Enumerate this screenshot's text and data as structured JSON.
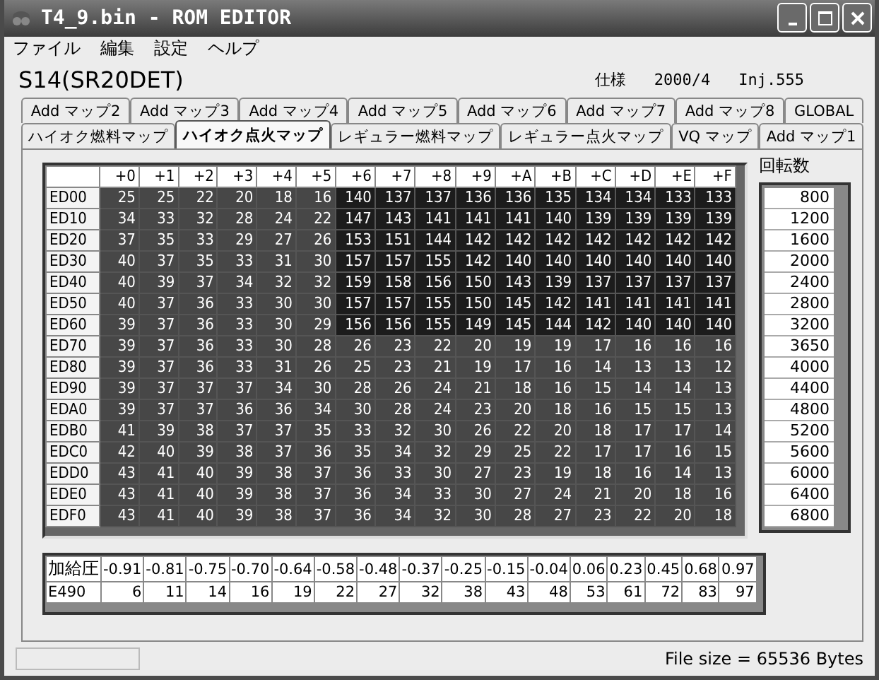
{
  "window": {
    "title": "T4_9.bin - ROM EDITOR"
  },
  "menu": [
    "ファイル",
    "編集",
    "設定",
    "ヘルプ"
  ],
  "header": {
    "model": "S14(SR20DET)",
    "spec_label": "仕様",
    "spec": "2000/4",
    "injector": "Inj.555"
  },
  "tab_rows": [
    [
      {
        "label": "Add マップ2",
        "selected": false
      },
      {
        "label": "Add マップ3",
        "selected": false
      },
      {
        "label": "Add マップ4",
        "selected": false
      },
      {
        "label": "Add マップ5",
        "selected": false
      },
      {
        "label": "Add マップ6",
        "selected": false
      },
      {
        "label": "Add マップ7",
        "selected": false
      },
      {
        "label": "Add マップ8",
        "selected": false
      },
      {
        "label": "GLOBAL",
        "selected": false
      }
    ],
    [
      {
        "label": "ハイオク燃料マップ",
        "selected": false
      },
      {
        "label": "ハイオク点火マップ",
        "selected": true
      },
      {
        "label": "レギュラー燃料マップ",
        "selected": false
      },
      {
        "label": "レギュラー点火マップ",
        "selected": false
      },
      {
        "label": "VQ マップ",
        "selected": false
      },
      {
        "label": "Add マップ1",
        "selected": false
      }
    ]
  ],
  "map": {
    "columns": [
      "+0",
      "+1",
      "+2",
      "+3",
      "+4",
      "+5",
      "+6",
      "+7",
      "+8",
      "+9",
      "+A",
      "+B",
      "+C",
      "+D",
      "+E",
      "+F"
    ],
    "rows": [
      {
        "address": "ED00",
        "values": [
          "25",
          "25",
          "22",
          "20",
          "18",
          "16",
          "140",
          "137",
          "137",
          "136",
          "136",
          "135",
          "134",
          "134",
          "133",
          "133"
        ]
      },
      {
        "address": "ED10",
        "values": [
          "34",
          "33",
          "32",
          "28",
          "24",
          "22",
          "147",
          "143",
          "141",
          "141",
          "141",
          "140",
          "139",
          "139",
          "139",
          "139"
        ]
      },
      {
        "address": "ED20",
        "values": [
          "37",
          "35",
          "33",
          "29",
          "27",
          "26",
          "153",
          "151",
          "144",
          "142",
          "142",
          "142",
          "142",
          "142",
          "142",
          "142"
        ]
      },
      {
        "address": "ED30",
        "values": [
          "40",
          "37",
          "35",
          "33",
          "31",
          "30",
          "157",
          "157",
          "155",
          "142",
          "140",
          "140",
          "140",
          "140",
          "140",
          "140"
        ]
      },
      {
        "address": "ED40",
        "values": [
          "40",
          "39",
          "37",
          "34",
          "32",
          "32",
          "159",
          "158",
          "156",
          "150",
          "143",
          "139",
          "137",
          "137",
          "137",
          "137"
        ]
      },
      {
        "address": "ED50",
        "values": [
          "40",
          "37",
          "36",
          "33",
          "30",
          "30",
          "157",
          "157",
          "155",
          "150",
          "145",
          "142",
          "141",
          "141",
          "141",
          "141"
        ]
      },
      {
        "address": "ED60",
        "values": [
          "39",
          "37",
          "36",
          "33",
          "30",
          "29",
          "156",
          "156",
          "155",
          "149",
          "145",
          "144",
          "142",
          "140",
          "140",
          "140"
        ]
      },
      {
        "address": "ED70",
        "values": [
          "39",
          "37",
          "36",
          "33",
          "30",
          "28",
          "26",
          "23",
          "22",
          "20",
          "19",
          "19",
          "17",
          "16",
          "16",
          "16"
        ]
      },
      {
        "address": "ED80",
        "values": [
          "39",
          "37",
          "36",
          "33",
          "31",
          "26",
          "25",
          "23",
          "21",
          "19",
          "17",
          "16",
          "14",
          "13",
          "13",
          "12"
        ]
      },
      {
        "address": "ED90",
        "values": [
          "39",
          "37",
          "37",
          "37",
          "34",
          "30",
          "28",
          "26",
          "24",
          "21",
          "18",
          "16",
          "15",
          "14",
          "14",
          "13"
        ]
      },
      {
        "address": "EDA0",
        "values": [
          "39",
          "37",
          "37",
          "36",
          "36",
          "34",
          "30",
          "28",
          "24",
          "23",
          "20",
          "18",
          "16",
          "15",
          "15",
          "13"
        ]
      },
      {
        "address": "EDB0",
        "values": [
          "41",
          "39",
          "38",
          "37",
          "37",
          "35",
          "33",
          "32",
          "30",
          "26",
          "22",
          "20",
          "18",
          "17",
          "17",
          "14"
        ]
      },
      {
        "address": "EDC0",
        "values": [
          "42",
          "40",
          "39",
          "38",
          "37",
          "36",
          "35",
          "34",
          "32",
          "29",
          "25",
          "22",
          "17",
          "17",
          "16",
          "15"
        ]
      },
      {
        "address": "EDD0",
        "values": [
          "43",
          "41",
          "40",
          "39",
          "38",
          "37",
          "36",
          "33",
          "30",
          "27",
          "23",
          "19",
          "18",
          "16",
          "14",
          "13"
        ]
      },
      {
        "address": "EDE0",
        "values": [
          "43",
          "41",
          "40",
          "39",
          "38",
          "37",
          "36",
          "34",
          "33",
          "30",
          "27",
          "24",
          "21",
          "20",
          "18",
          "16"
        ]
      },
      {
        "address": "EDF0",
        "values": [
          "43",
          "41",
          "40",
          "39",
          "38",
          "37",
          "36",
          "34",
          "32",
          "30",
          "28",
          "27",
          "23",
          "22",
          "20",
          "18"
        ]
      }
    ]
  },
  "rpm": {
    "label": "回転数",
    "values": [
      "800",
      "1200",
      "1600",
      "2000",
      "2400",
      "2800",
      "3200",
      "3650",
      "4000",
      "4400",
      "4800",
      "5200",
      "5600",
      "6000",
      "6400",
      "6800"
    ]
  },
  "boost": {
    "label": "加給圧",
    "columns": [
      "-0.91",
      "-0.81",
      "-0.75",
      "-0.70",
      "-0.64",
      "-0.58",
      "-0.48",
      "-0.37",
      "-0.25",
      "-0.15",
      "-0.04",
      "0.06",
      "0.23",
      "0.45",
      "0.68",
      "0.97"
    ],
    "row_label": "E490",
    "values": [
      "6",
      "11",
      "14",
      "16",
      "19",
      "22",
      "27",
      "32",
      "38",
      "43",
      "48",
      "53",
      "61",
      "72",
      "83",
      "97"
    ]
  },
  "status_bar": {
    "file_size": "File size =  65536 Bytes"
  }
}
